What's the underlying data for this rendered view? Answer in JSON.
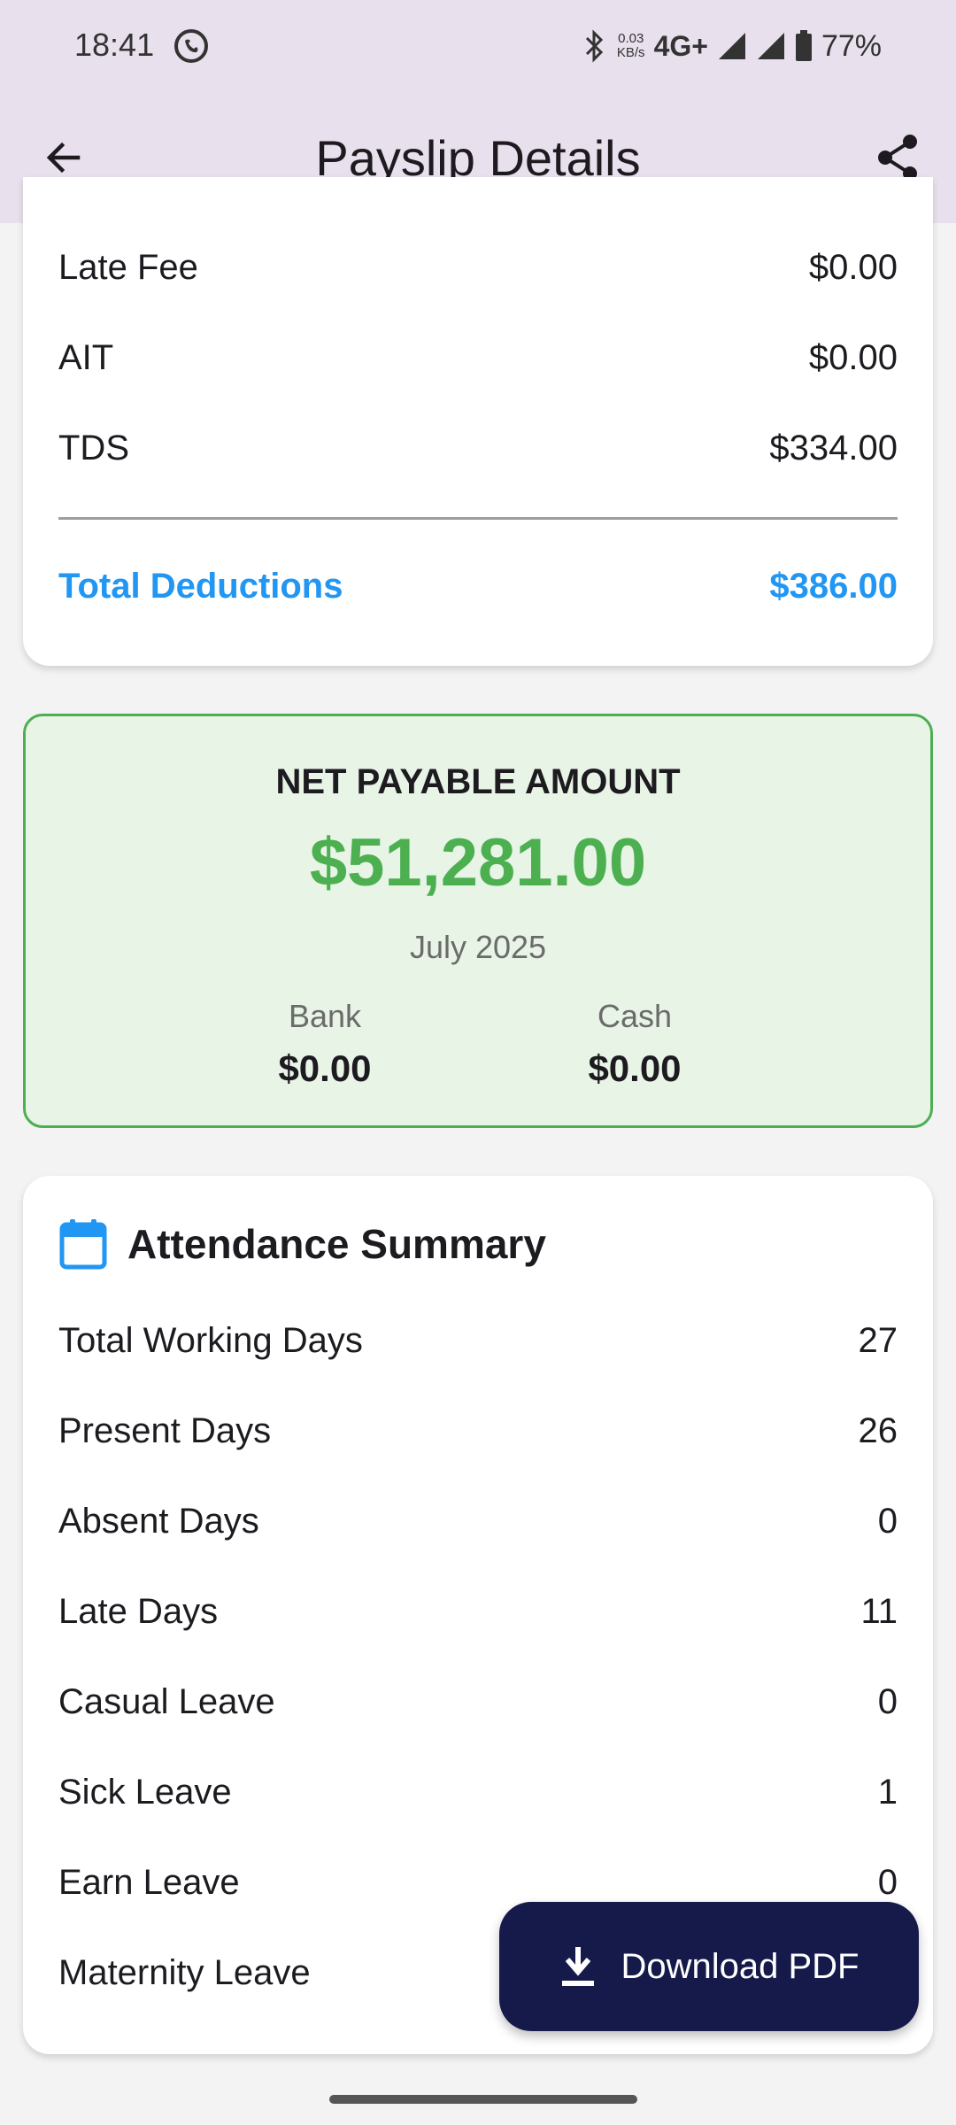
{
  "status_bar": {
    "time": "18:41",
    "net_speed_value": "0.03",
    "net_speed_unit": "KB/s",
    "network_type": "4G+",
    "battery": "77%"
  },
  "app_bar": {
    "title": "Payslip Details"
  },
  "deductions": {
    "items": [
      {
        "label": "Late Fee",
        "value": "$0.00"
      },
      {
        "label": "AIT",
        "value": "$0.00"
      },
      {
        "label": "TDS",
        "value": "$334.00"
      }
    ],
    "total_label": "Total Deductions",
    "total_value": "$386.00"
  },
  "net_payable": {
    "label": "NET PAYABLE AMOUNT",
    "amount": "$51,281.00",
    "period": "July 2025",
    "bank_label": "Bank",
    "bank_value": "$0.00",
    "cash_label": "Cash",
    "cash_value": "$0.00"
  },
  "attendance": {
    "title": "Attendance Summary",
    "items": [
      {
        "label": "Total Working Days",
        "value": "27"
      },
      {
        "label": "Present Days",
        "value": "26"
      },
      {
        "label": "Absent Days",
        "value": "0"
      },
      {
        "label": "Late Days",
        "value": "11"
      },
      {
        "label": "Casual Leave",
        "value": "0"
      },
      {
        "label": "Sick Leave",
        "value": "1"
      },
      {
        "label": "Earn Leave",
        "value": "0"
      },
      {
        "label": "Maternity Leave",
        "value": ""
      }
    ]
  },
  "fab": {
    "label": "Download PDF"
  },
  "colors": {
    "app_bar_bg": "#e8e0ec",
    "accent_blue": "#2196f3",
    "net_green": "#4caf50",
    "net_card_bg": "#e7f4e6",
    "fab_bg": "#151a4a"
  },
  "icons": [
    "back-arrow-icon",
    "share-icon",
    "calendar-icon",
    "download-icon",
    "bluetooth-icon",
    "signal-icon",
    "battery-icon"
  ]
}
